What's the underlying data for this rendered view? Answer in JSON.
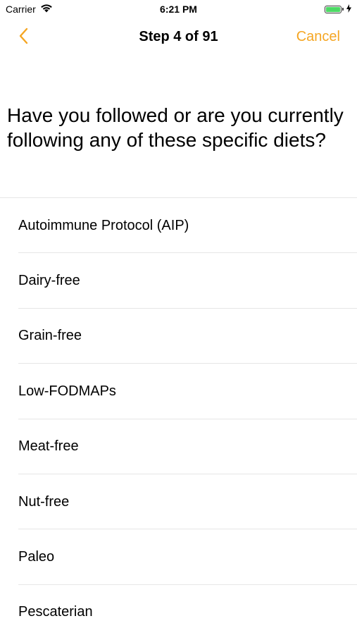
{
  "status_bar": {
    "carrier": "Carrier",
    "time": "6:21 PM",
    "battery_level": 1.0,
    "battery_color": "#4cd964",
    "wifi_icon": "wifi-icon",
    "charging_icon": "bolt-icon"
  },
  "nav": {
    "back_icon": "chevron-left-icon",
    "title": "Step 4 of 91",
    "cancel_label": "Cancel",
    "accent_color": "#f5a623"
  },
  "question": "Have you followed or are you currently following any of these specific diets?",
  "options": [
    {
      "label": "Autoimmune Protocol (AIP)"
    },
    {
      "label": "Dairy-free"
    },
    {
      "label": "Grain-free"
    },
    {
      "label": "Low-FODMAPs"
    },
    {
      "label": "Meat-free"
    },
    {
      "label": "Nut-free"
    },
    {
      "label": "Paleo"
    },
    {
      "label": "Pescaterian"
    }
  ]
}
